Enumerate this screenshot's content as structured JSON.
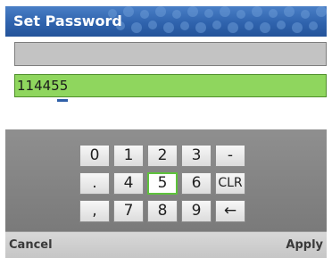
{
  "dialog": {
    "title": "Set Password"
  },
  "fields": {
    "first_value": "",
    "second_value": "114455"
  },
  "keypad": {
    "row1": [
      "0",
      "1",
      "2",
      "3",
      "-"
    ],
    "row2": [
      ".",
      "4",
      "5",
      "6",
      "CLR"
    ],
    "row3": [
      ",",
      "7",
      "8",
      "9",
      "←"
    ],
    "selected_key": "5"
  },
  "softkeys": {
    "left": "Cancel",
    "right": "Apply"
  },
  "colors": {
    "title_bar": "#2f63ad",
    "active_field": "#8fd65e",
    "selected_key_border": "#5ec23c"
  }
}
